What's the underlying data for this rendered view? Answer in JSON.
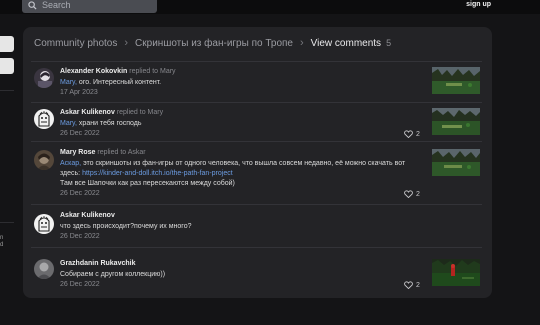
{
  "header": {
    "search_placeholder": "Search",
    "signup_label": "sign up"
  },
  "sidebar": {
    "text_lines": [
      "n",
      "d"
    ]
  },
  "breadcrumb": {
    "items": [
      "Community photos",
      "Скриншоты из фан-игры по Тропе"
    ],
    "current": "View comments",
    "count": "5"
  },
  "comments": [
    {
      "author": "Alexander Kokovkin",
      "replied": "replied to Mary",
      "mention": "Mary,",
      "text": " ого. Интересный контент.",
      "date": "17 Apr 2023",
      "likes": ""
    },
    {
      "author": "Askar Kulikenov",
      "replied": "replied to Mary",
      "mention": "Mary,",
      "text": " храни тебя господь",
      "date": "26 Dec 2022",
      "likes": "2"
    },
    {
      "author": "Mary Rose",
      "replied": "replied to Askar",
      "mention": "Аскар,",
      "text": " это скриншоты из фан-игры от одного человека, что вышла совсем недавно, её можно скачать вот здесь: ",
      "link": "https://kinder-and-doll.itch.io/the-path-fan-project",
      "text2": "Там все Шапочки как раз пересекаются между собой)",
      "date": "26 Dec 2022",
      "likes": "2"
    },
    {
      "author": "Askar Kulikenov",
      "replied": "",
      "text": "что здесь происходит?почему их много?",
      "date": "26 Dec 2022",
      "likes": ""
    },
    {
      "author": "Grazhdanin Rukavchik",
      "replied": "",
      "text": "Собираем с другом коллекцию))",
      "date": "26 Dec 2022",
      "likes": "2"
    }
  ],
  "colors": {
    "background": "#141416",
    "panel": "#232326",
    "link": "#6b9be0"
  }
}
